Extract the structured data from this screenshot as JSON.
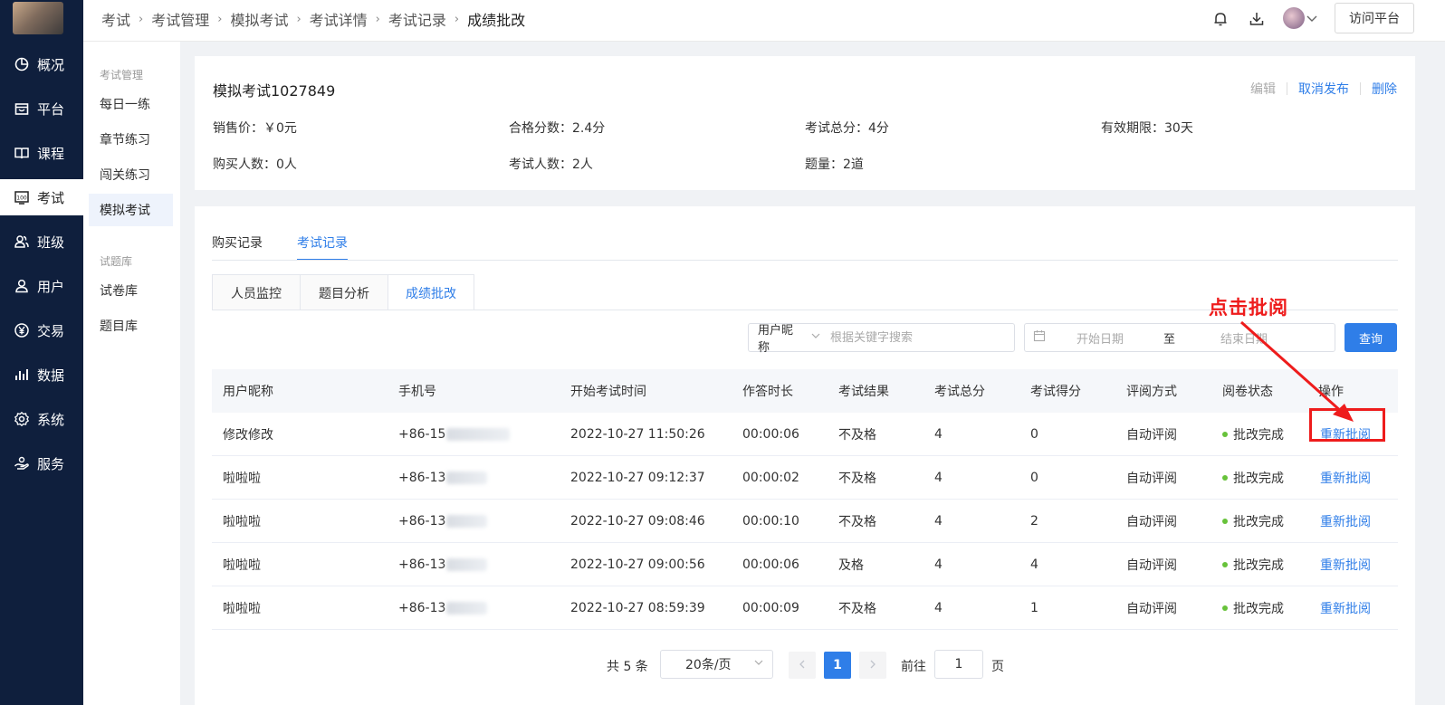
{
  "sidebar": {
    "items": [
      {
        "label": "概况",
        "icon": "chart-pie-icon"
      },
      {
        "label": "平台",
        "icon": "store-icon"
      },
      {
        "label": "课程",
        "icon": "book-icon"
      },
      {
        "label": "考试",
        "icon": "exam-score-icon",
        "active": true
      },
      {
        "label": "班级",
        "icon": "users-group-icon"
      },
      {
        "label": "用户",
        "icon": "user-icon"
      },
      {
        "label": "交易",
        "icon": "yuan-icon"
      },
      {
        "label": "数据",
        "icon": "bar-chart-icon"
      },
      {
        "label": "系统",
        "icon": "gear-icon"
      },
      {
        "label": "服务",
        "icon": "service-hand-icon"
      }
    ]
  },
  "header": {
    "breadcrumb": [
      "考试",
      "考试管理",
      "模拟考试",
      "考试详情",
      "考试记录",
      "成绩批改"
    ],
    "visit_label": "访问平台"
  },
  "subnav": {
    "group1_title": "考试管理",
    "group1_items": [
      "每日一练",
      "章节练习",
      "闯关练习",
      "模拟考试"
    ],
    "group2_title": "试题库",
    "group2_items": [
      "试卷库",
      "题目库"
    ]
  },
  "exam": {
    "title": "模拟考试1027849",
    "actions": {
      "edit": "编辑",
      "unpublish": "取消发布",
      "delete": "删除"
    },
    "price": "销售价：￥0元",
    "pass_score": "合格分数：2.4分",
    "total_score": "考试总分：4分",
    "validity": "有效期限：30天",
    "buyers": "购买人数：0人",
    "takers": "考试人数：2人",
    "questions": "题量：2道"
  },
  "tabs": {
    "purchase": "购买记录",
    "exam_records": "考试记录"
  },
  "subtabs": {
    "monitor": "人员监控",
    "analysis": "题目分析",
    "grading": "成绩批改"
  },
  "search": {
    "field": "用户昵称",
    "placeholder": "根据关键字搜索",
    "start_placeholder": "开始日期",
    "to": "至",
    "end_placeholder": "结束日期",
    "query": "查询"
  },
  "table": {
    "columns": [
      "用户昵称",
      "手机号",
      "开始考试时间",
      "作答时长",
      "考试结果",
      "考试总分",
      "考试得分",
      "评阅方式",
      "阅卷状态",
      "操作"
    ],
    "rows": [
      {
        "name": "修改修改",
        "phone": "+86-15",
        "start": "2022-10-27 11:50:26",
        "duration": "00:00:06",
        "result": "不及格",
        "total": "4",
        "score": "0",
        "review": "自动评阅",
        "status": "批改完成",
        "op": "重新批阅"
      },
      {
        "name": "啦啦啦",
        "phone": "+86-13",
        "start": "2022-10-27 09:12:37",
        "duration": "00:00:02",
        "result": "不及格",
        "total": "4",
        "score": "0",
        "review": "自动评阅",
        "status": "批改完成",
        "op": "重新批阅"
      },
      {
        "name": "啦啦啦",
        "phone": "+86-13",
        "start": "2022-10-27 09:08:46",
        "duration": "00:00:10",
        "result": "不及格",
        "total": "4",
        "score": "2",
        "review": "自动评阅",
        "status": "批改完成",
        "op": "重新批阅"
      },
      {
        "name": "啦啦啦",
        "phone": "+86-13",
        "start": "2022-10-27 09:00:56",
        "duration": "00:00:06",
        "result": "及格",
        "total": "4",
        "score": "4",
        "review": "自动评阅",
        "status": "批改完成",
        "op": "重新批阅"
      },
      {
        "name": "啦啦啦",
        "phone": "+86-13",
        "start": "2022-10-27 08:59:39",
        "duration": "00:00:09",
        "result": "不及格",
        "total": "4",
        "score": "1",
        "review": "自动评阅",
        "status": "批改完成",
        "op": "重新批阅"
      }
    ]
  },
  "pager": {
    "total": "共 5 条",
    "page_size": "20条/页",
    "current_page": "1",
    "goto_label": "前往",
    "goto_value": "1",
    "goto_suffix": "页"
  },
  "annotation": {
    "text": "点击批阅",
    "color": "#ee1c1c"
  },
  "colors": {
    "accent": "#2f7ee8",
    "sidebar_bg": "#0f1f3d",
    "success": "#67c23a"
  }
}
